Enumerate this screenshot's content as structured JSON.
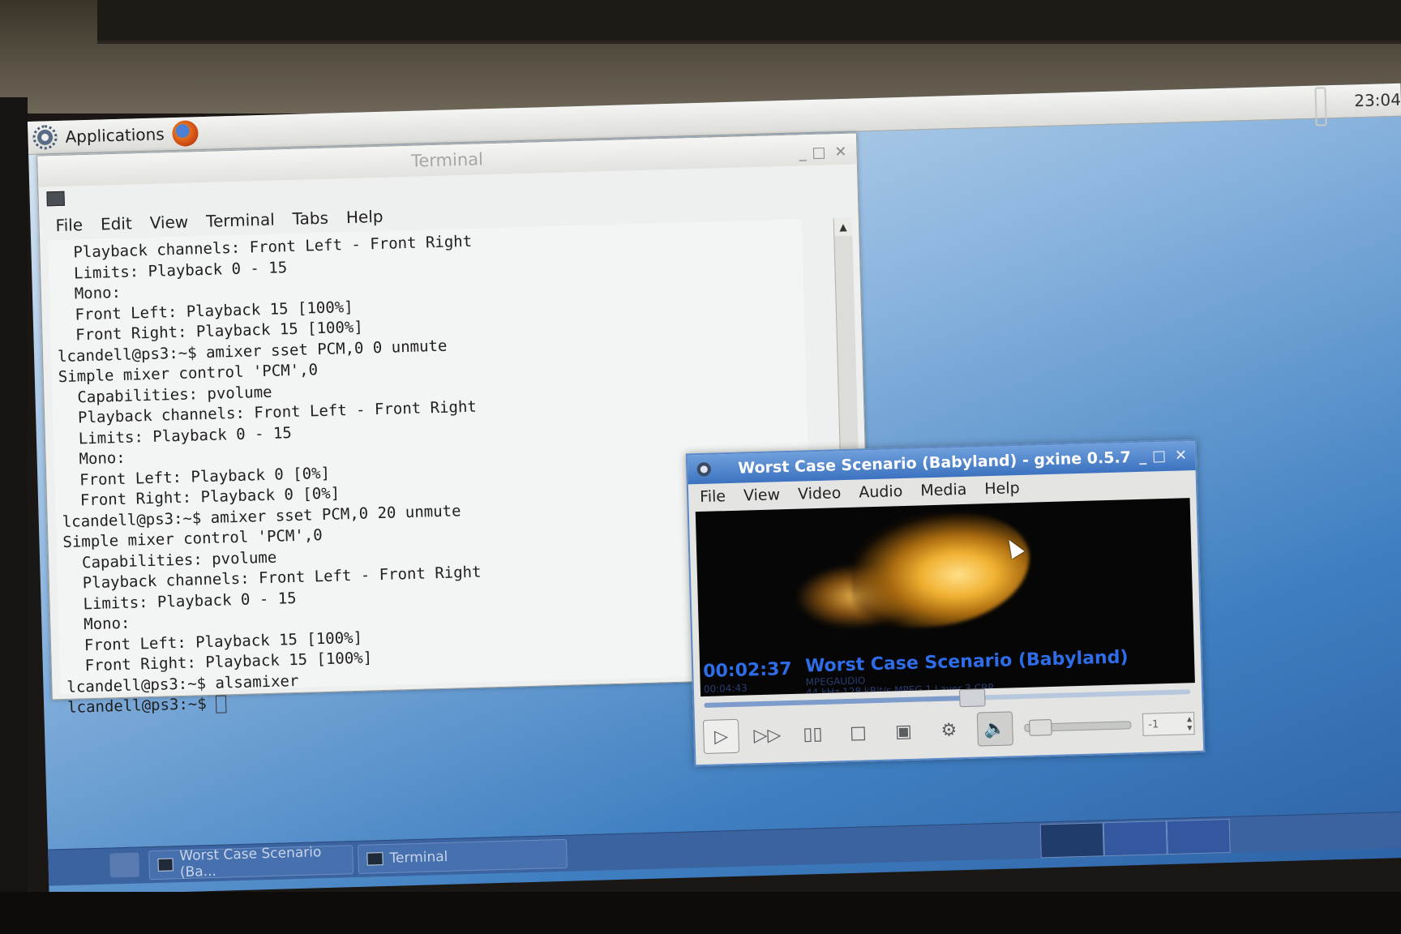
{
  "top_panel": {
    "applications_label": "Applications",
    "clock": "23:04"
  },
  "terminal": {
    "title": "Terminal",
    "menu": [
      "File",
      "Edit",
      "View",
      "Terminal",
      "Tabs",
      "Help"
    ],
    "lines": [
      "  Playback channels: Front Left - Front Right",
      "  Limits: Playback 0 - 15",
      "  Mono:",
      "  Front Left: Playback 15 [100%]",
      "  Front Right: Playback 15 [100%]",
      "lcandell@ps3:~$ amixer sset PCM,0 0 unmute",
      "Simple mixer control 'PCM',0",
      "  Capabilities: pvolume",
      "  Playback channels: Front Left - Front Right",
      "  Limits: Playback 0 - 15",
      "  Mono:",
      "  Front Left: Playback 0 [0%]",
      "  Front Right: Playback 0 [0%]",
      "lcandell@ps3:~$ amixer sset PCM,0 20 unmute",
      "Simple mixer control 'PCM',0",
      "  Capabilities: pvolume",
      "  Playback channels: Front Left - Front Right",
      "  Limits: Playback 0 - 15",
      "  Mono:",
      "  Front Left: Playback 15 [100%]",
      "  Front Right: Playback 15 [100%]",
      "lcandell@ps3:~$ alsamixer",
      "",
      "lcandell@ps3:~$ "
    ]
  },
  "gxine": {
    "title": "Worst Case Scenario (Babyland) - gxine 0.5.7",
    "menu": [
      "File",
      "View",
      "Video",
      "Audio",
      "Media",
      "Help"
    ],
    "osd": {
      "elapsed": "00:02:37",
      "total": "00:04:43",
      "track_title": "Worst Case Scenario (Babyland)",
      "codec": "MPEGAUDIO",
      "stream_info": "44 kHz 128 kBit/s MPEG 1 Layer 3 CBR"
    },
    "seek_fraction": 0.55,
    "volume_fraction": 0.05,
    "spin_value": "-1",
    "controls": {
      "play": "▷",
      "fast_forward": "▷▷",
      "pause": "▯▯",
      "stop": "□",
      "snapshot": "▣",
      "settings": "⚙",
      "mute": "🔈"
    }
  },
  "taskbar": {
    "tasks": [
      "Worst Case Scenario (Ba...",
      "Terminal"
    ]
  }
}
